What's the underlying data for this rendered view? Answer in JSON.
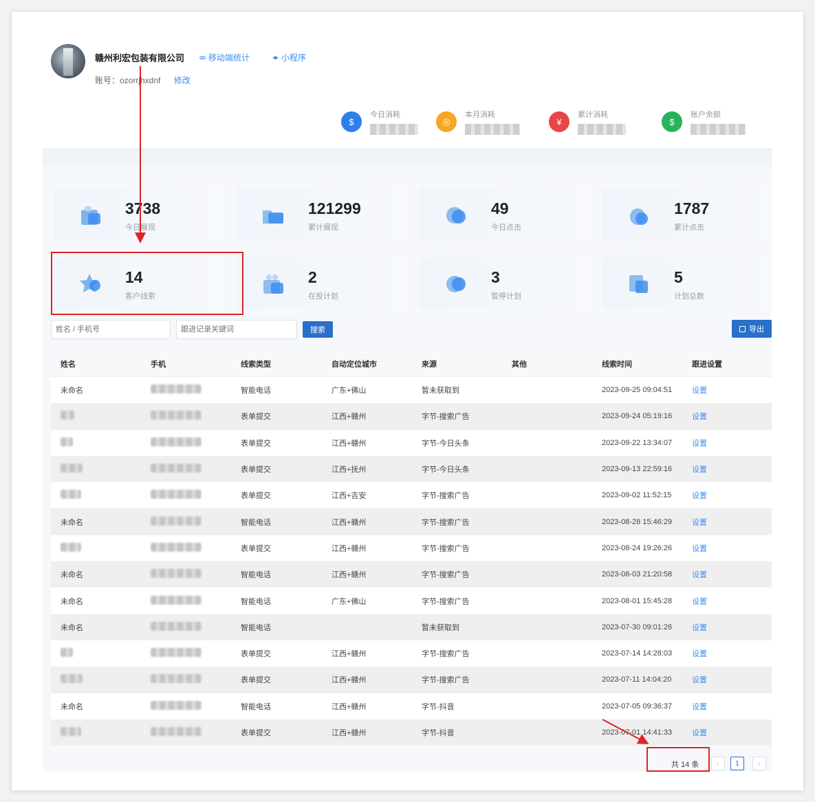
{
  "header": {
    "company": "赣州利宏包装有限公司",
    "links": [
      "移动端统计",
      "小程序"
    ],
    "account_label": "账号：ozorrjhxdnf",
    "edit_label": "修改"
  },
  "costs": [
    {
      "label": "今日消耗",
      "icon": "hand-coin-icon",
      "color": "#2f7fea"
    },
    {
      "label": "本月消耗",
      "icon": "calendar-coin-icon",
      "color": "#f5a623"
    },
    {
      "label": "累计消耗",
      "icon": "stack-coin-icon",
      "color": "#e84545"
    },
    {
      "label": "账户余额",
      "icon": "money-bag-icon",
      "color": "#27b35c"
    }
  ],
  "stats": [
    {
      "value": "3738",
      "label": "今日展现",
      "icon": "briefcase-icon"
    },
    {
      "value": "121299",
      "label": "累计展现",
      "icon": "folder-icon"
    },
    {
      "value": "49",
      "label": "今日点击",
      "icon": "cursor-click-icon"
    },
    {
      "value": "1787",
      "label": "累计点击",
      "icon": "cloud-icon"
    },
    {
      "value": "14",
      "label": "客户线索",
      "icon": "star-chat-icon"
    },
    {
      "value": "2",
      "label": "在投计划",
      "icon": "gift-icon"
    },
    {
      "value": "3",
      "label": "暂停计划",
      "icon": "pause-icon"
    },
    {
      "value": "5",
      "label": "计划总数",
      "icon": "document-icon"
    }
  ],
  "search": {
    "name_placeholder": "姓名 / 手机号",
    "keyword_placeholder": "跟进记录关键词",
    "search_label": "搜索",
    "export_label": "导出"
  },
  "table": {
    "headers": [
      "姓名",
      "手机",
      "线索类型",
      "自动定位城市",
      "来源",
      "其他",
      "线索时间",
      "跟进设置"
    ],
    "rows": [
      {
        "name": "未命名",
        "type": "智能电话",
        "city": "广东+佛山",
        "source": "暂未获取到",
        "time": "2023-09-25 09:04:51",
        "action": "设置"
      },
      {
        "name": "",
        "type": "表单提交",
        "city": "江西+赣州",
        "source": "字节-搜索广告",
        "time": "2023-09-24 05:19:16",
        "action": "设置"
      },
      {
        "name": "",
        "type": "表单提交",
        "city": "江西+赣州",
        "source": "字节-今日头条",
        "time": "2023-09-22 13:34:07",
        "action": "设置"
      },
      {
        "name": "",
        "type": "表单提交",
        "city": "江西+抚州",
        "source": "字节-今日头条",
        "time": "2023-09-13 22:59:16",
        "action": "设置"
      },
      {
        "name": "",
        "type": "表单提交",
        "city": "江西+吉安",
        "source": "字节-搜索广告",
        "time": "2023-09-02 11:52:15",
        "action": "设置"
      },
      {
        "name": "未命名",
        "type": "智能电话",
        "city": "江西+赣州",
        "source": "字节-搜索广告",
        "time": "2023-08-28 15:46:29",
        "action": "设置"
      },
      {
        "name": "",
        "type": "表单提交",
        "city": "江西+赣州",
        "source": "字节-搜索广告",
        "time": "2023-08-24 19:26:26",
        "action": "设置"
      },
      {
        "name": "未命名",
        "type": "智能电话",
        "city": "江西+赣州",
        "source": "字节-搜索广告",
        "time": "2023-08-03 21:20:58",
        "action": "设置"
      },
      {
        "name": "未命名",
        "type": "智能电话",
        "city": "广东+佛山",
        "source": "字节-搜索广告",
        "time": "2023-08-01 15:45:28",
        "action": "设置"
      },
      {
        "name": "未命名",
        "type": "智能电话",
        "city": "",
        "source": "暂未获取到",
        "time": "2023-07-30 09:01:26",
        "action": "设置"
      },
      {
        "name": "",
        "type": "表单提交",
        "city": "江西+赣州",
        "source": "字节-搜索广告",
        "time": "2023-07-14 14:28:03",
        "action": "设置"
      },
      {
        "name": "",
        "type": "表单提交",
        "city": "江西+赣州",
        "source": "字节-搜索广告",
        "time": "2023-07-11 14:04:20",
        "action": "设置"
      },
      {
        "name": "未命名",
        "type": "智能电话",
        "city": "江西+赣州",
        "source": "字节-抖音",
        "time": "2023-07-05 09:36:37",
        "action": "设置"
      },
      {
        "name": "",
        "type": "表单提交",
        "city": "江西+赣州",
        "source": "字节-抖音",
        "time": "2023-07-01 14:41:33",
        "action": "设置"
      }
    ]
  },
  "pagination": {
    "total": "共 14 条",
    "current": "1",
    "prev": "‹",
    "next": "›"
  },
  "colors": {
    "accent": "#2a6fc9",
    "link": "#3d8ef0",
    "annotation": "#e02424"
  }
}
